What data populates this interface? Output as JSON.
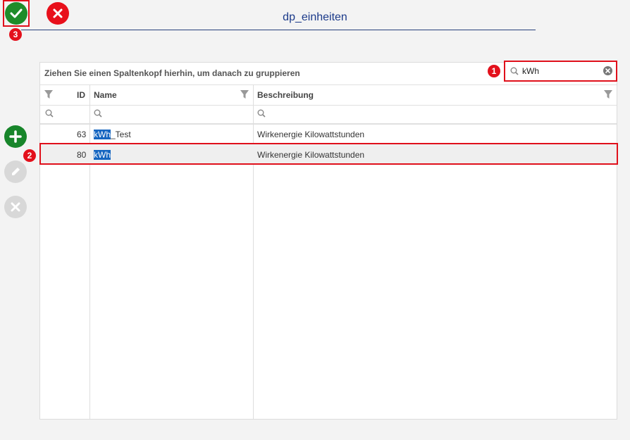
{
  "window": {
    "title": "dp_einheiten"
  },
  "toolbar": {
    "ok_icon": "check-icon",
    "cancel_icon": "close-icon"
  },
  "badges": {
    "b1": "1",
    "b2": "2",
    "b3": "3"
  },
  "grid": {
    "group_hint": "Ziehen Sie einen Spaltenkopf hierhin, um danach zu gruppieren",
    "search_value": "kWh",
    "columns": {
      "id": "ID",
      "name": "Name",
      "description": "Beschreibung"
    },
    "rows": [
      {
        "id": "63",
        "name_match": "kWh",
        "name_rest": "_Test",
        "description": "Wirkenergie Kilowattstunden"
      },
      {
        "id": "80",
        "name_match": "kWh",
        "name_rest": "",
        "description": "Wirkenergie Kilowattstunden"
      }
    ]
  },
  "side_actions": {
    "add": "plus-icon",
    "edit": "pencil-icon",
    "delete": "close-icon"
  },
  "colors": {
    "accent_green": "#1e8c2a",
    "accent_red": "#e8101b",
    "title_blue": "#1b3a8a",
    "highlight": "#1565c0"
  }
}
